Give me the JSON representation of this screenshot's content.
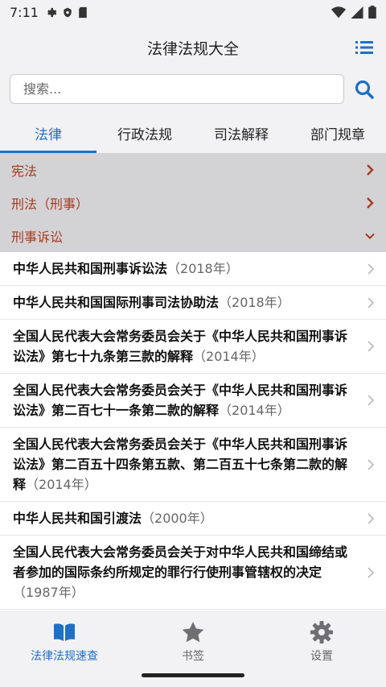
{
  "status_bar": {
    "time": "7:11"
  },
  "header": {
    "title": "法律法规大全"
  },
  "search": {
    "placeholder": "搜索..."
  },
  "tabs": [
    {
      "label": "法律",
      "active": true
    },
    {
      "label": "行政法规",
      "active": false
    },
    {
      "label": "司法解释",
      "active": false
    },
    {
      "label": "部门规章",
      "active": false
    }
  ],
  "categories": [
    {
      "label": "宪法",
      "expanded": false
    },
    {
      "label": "刑法（刑事）",
      "expanded": false
    },
    {
      "label": "刑事诉讼",
      "expanded": true
    }
  ],
  "laws": [
    {
      "title": "中华人民共和国刑事诉讼法",
      "year": "（2018年）"
    },
    {
      "title": "中华人民共和国国际刑事司法协助法",
      "year": "（2018年）"
    },
    {
      "title": "全国人民代表大会常务委员会关于《中华人民共和国刑事诉讼法》第七十九条第三款的解释",
      "year": "（2014年）"
    },
    {
      "title": "全国人民代表大会常务委员会关于《中华人民共和国刑事诉讼法》第二百七十一条第二款的解释",
      "year": "（2014年）"
    },
    {
      "title": "全国人民代表大会常务委员会关于《中华人民共和国刑事诉讼法》第二百五十四条第五款、第二百五十七条第二款的解释",
      "year": "（2014年）"
    },
    {
      "title": "中华人民共和国引渡法",
      "year": "（2000年）"
    },
    {
      "title": "全国人民代表大会常务委员会关于对中华人民共和国缔结或者参加的国际条约所规定的罪行行使刑事管辖权的决定",
      "year": "（1987年）"
    }
  ],
  "bottom_nav": [
    {
      "label": "法律法规速查",
      "icon": "book-icon",
      "active": true
    },
    {
      "label": "书签",
      "icon": "star-icon",
      "active": false
    },
    {
      "label": "设置",
      "icon": "gear-icon",
      "active": false
    }
  ],
  "colors": {
    "accent": "#1f6fc5",
    "category_text": "#a63a1e",
    "category_bg": "#d3d3d6"
  }
}
